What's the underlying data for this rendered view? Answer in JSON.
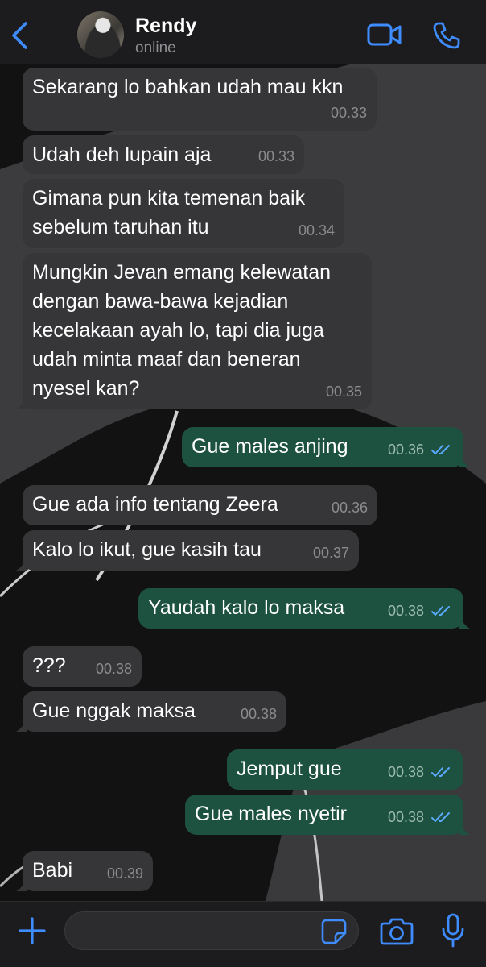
{
  "header": {
    "back_icon": "chevron-left-icon",
    "contact_name": "Rendy",
    "status": "online",
    "video_icon": "video-camera-icon",
    "call_icon": "phone-icon",
    "accent": "#3f8cff"
  },
  "messages": [
    {
      "dir": "in",
      "text": "Sekarang lo bahkan udah mau kkn",
      "time": "00.33"
    },
    {
      "dir": "in",
      "text": "Udah deh lupain aja",
      "time": "00.33"
    },
    {
      "dir": "in",
      "text": "Gimana pun kita temenan baik\nsebelum taruhan itu",
      "time": "00.34"
    },
    {
      "dir": "in",
      "text": "Mungkin Jevan emang kelewatan\ndengan bawa-bawa kejadian\nkecelakaan ayah lo, tapi dia juga\nudah minta maaf dan beneran\nnyesel kan?",
      "time": "00.35"
    },
    {
      "dir": "out",
      "text": "Gue males anjing",
      "time": "00.36",
      "read": true
    },
    {
      "dir": "in",
      "text": "Gue ada info tentang Zeera",
      "time": "00.36"
    },
    {
      "dir": "in",
      "text": "Kalo lo ikut, gue kasih tau",
      "time": "00.37"
    },
    {
      "dir": "out",
      "text": "Yaudah kalo lo maksa",
      "time": "00.38",
      "read": true
    },
    {
      "dir": "in",
      "text": "???",
      "time": "00.38"
    },
    {
      "dir": "in",
      "text": "Gue nggak maksa",
      "time": "00.38"
    },
    {
      "dir": "out",
      "text": "Jemput gue",
      "time": "00.38",
      "read": true
    },
    {
      "dir": "out",
      "text": "Gue males nyetir",
      "time": "00.38",
      "read": true
    },
    {
      "dir": "in",
      "text": "Babi",
      "time": "00.39"
    }
  ],
  "composer": {
    "plus_icon": "plus-icon",
    "placeholder": "",
    "sticker_icon": "sticker-icon",
    "camera_icon": "camera-icon",
    "mic_icon": "microphone-icon"
  },
  "colors": {
    "incoming_bubble": "#363638",
    "outgoing_bubble": "#1d5140",
    "read_ticks": "#5aa9ff"
  }
}
